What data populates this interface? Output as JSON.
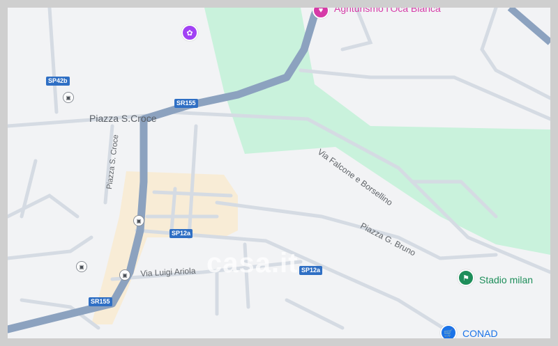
{
  "colors": {
    "map_background": "#f2f3f5",
    "park": "#c9f2dc",
    "urban_area": "#f8ecd6",
    "major_road": "#8ca2bf",
    "minor_road": "#d5dbe3",
    "shield": "#2f6fc4",
    "poi_magenta": "#d63aa7",
    "poi_green": "#1e8e5a",
    "poi_blue": "#1a73e8"
  },
  "places": {
    "piazza_s_croce": "Piazza S.Croce",
    "agriturismo": "Agriturismo l'Oca Bianca",
    "stadio": "Stadio milan",
    "conad": "CONAD"
  },
  "streets": {
    "via_falcone": "Via Falcone e Borsellino",
    "piazza_s_croce_vertical": "Piazza S. Croce",
    "piazza_g_bruno": "Piazza G. Bruno",
    "via_luigi_ariola": "Via Luigi Ariola"
  },
  "shields": {
    "sp42b": "SP42b",
    "sr155_top": "SR155",
    "sr155_bottom": "SR155",
    "sp12a_left": "SP12a",
    "sp12a_right": "SP12a"
  },
  "icons": {
    "bus": "bus-stop-icon",
    "agriturismo": "restaurant-icon",
    "stadio": "stadium-icon",
    "conad": "shopping-cart-icon",
    "purple_poi": "purple-poi-icon"
  },
  "watermark": "casa.it"
}
